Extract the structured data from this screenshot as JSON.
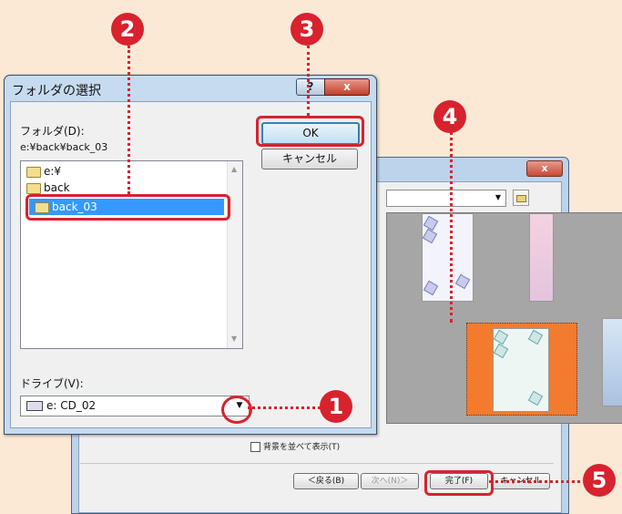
{
  "background_window": {
    "close_label": "x",
    "checkbox_label": "背景を並べて表示(T)",
    "buttons": {
      "back": "＜戻る(B)",
      "next": "次へ(N)＞",
      "finish": "完了(F)",
      "cancel": "キャンセル"
    }
  },
  "folder_dialog": {
    "title": "フォルダの選択",
    "help_label": "?",
    "close_label": "x",
    "folder_label": "フォルダ(D):",
    "current_path": "e:¥back¥back_03",
    "tree_items": [
      "e:¥",
      "back",
      "back_03"
    ],
    "ok_label": "OK",
    "cancel_label": "キャンセル",
    "drive_label": "ドライブ(V):",
    "drive_value": "e: CD_02"
  },
  "callouts": [
    "1",
    "2",
    "3",
    "4",
    "5"
  ],
  "colors": {
    "callout_red": "#d8222e",
    "selection_blue": "#3399ff",
    "selected_thumb_orange": "#f47a2e",
    "page_bg": "#fbe9d6"
  }
}
